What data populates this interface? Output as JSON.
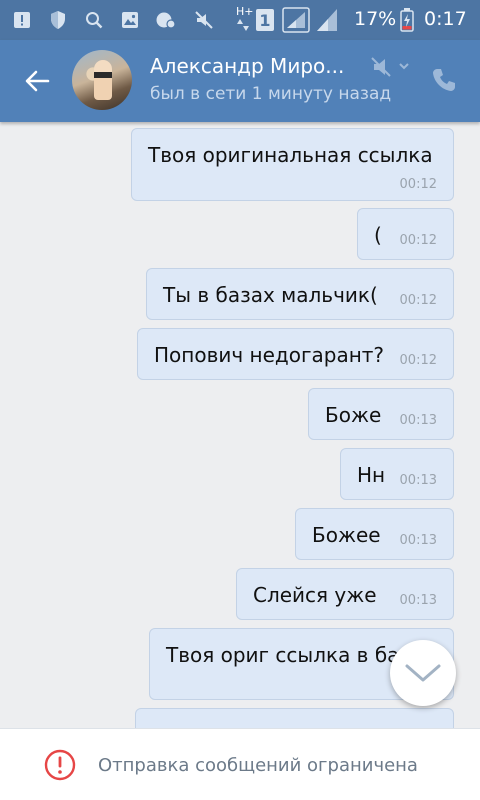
{
  "status_bar": {
    "battery_percent": "17%",
    "time": "0:17",
    "network": "H+",
    "sim": "1",
    "icons": [
      "notification-icon",
      "shield-icon",
      "search-icon",
      "image-icon",
      "vk-icon",
      "silent-icon",
      "signal-icon",
      "battery-icon"
    ]
  },
  "header": {
    "name": "Александр Миро...",
    "status": "был в сети 1 минуту назад"
  },
  "messages": [
    {
      "text": "Твоя оригинальная ссылка",
      "time": "00:12"
    },
    {
      "text": "(",
      "time": "00:12"
    },
    {
      "text": "Ты в базах мальчик(",
      "time": "00:12"
    },
    {
      "text": "Попович недогарант?",
      "time": "00:12"
    },
    {
      "text": "Боже",
      "time": "00:13"
    },
    {
      "text": "Нн",
      "time": "00:13"
    },
    {
      "text": "Божее",
      "time": "00:13"
    },
    {
      "text": "Слейся уже",
      "time": "00:13"
    },
    {
      "text": "Твоя ориг ссылка в ба",
      "time": ""
    }
  ],
  "bottom_bar": {
    "text": "Отправка сообщений ограничена"
  },
  "colors": {
    "header": "#5181b8",
    "status_bar": "#4d75a3",
    "bubble": "#dde8f7",
    "background": "#edeef0",
    "warning": "#e64646"
  }
}
